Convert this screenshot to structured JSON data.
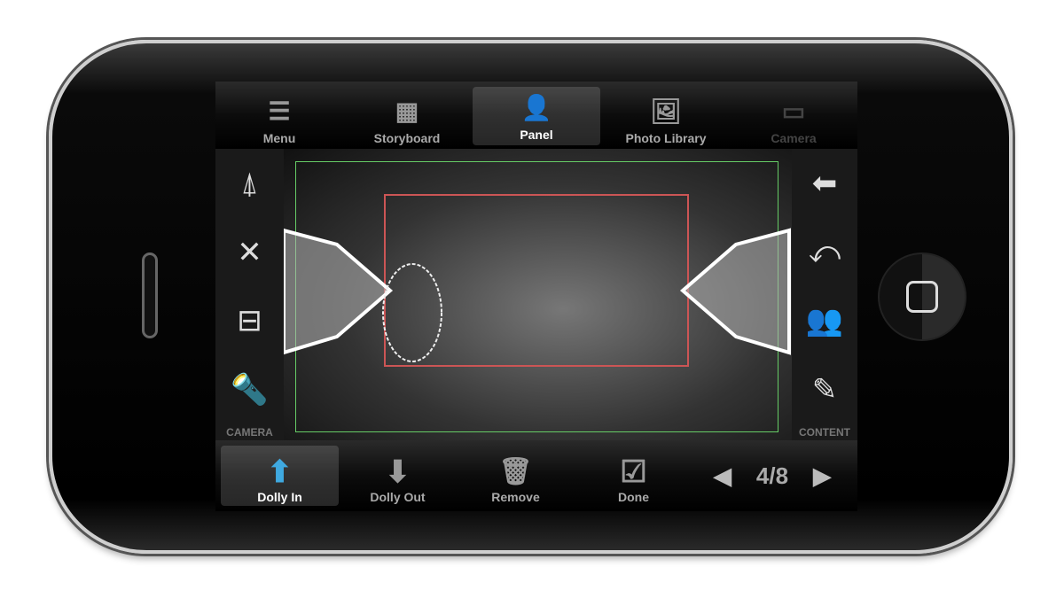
{
  "top_toolbar": {
    "items": [
      {
        "label": "Menu",
        "icon": "list-icon"
      },
      {
        "label": "Storyboard",
        "icon": "storyboard-icon"
      },
      {
        "label": "Panel",
        "icon": "person-panel-icon",
        "selected": true
      },
      {
        "label": "Photo Library",
        "icon": "photos-icon"
      },
      {
        "label": "Camera",
        "icon": "camera-icon",
        "disabled": true
      }
    ]
  },
  "left_panel": {
    "label": "CAMERA",
    "icons": [
      "ladder-icon",
      "collapse-arrows-icon",
      "track-icon",
      "flashlight-icon"
    ]
  },
  "right_panel": {
    "label": "CONTENT",
    "icons": [
      "arrow-left-icon",
      "rotate-icon",
      "figures-icon",
      "pencil-icon"
    ]
  },
  "bottom_toolbar": {
    "items": [
      {
        "label": "Dolly In",
        "icon": "arrow-up-icon",
        "selected": true
      },
      {
        "label": "Dolly Out",
        "icon": "arrow-down-icon"
      },
      {
        "label": "Remove",
        "icon": "trash-icon"
      },
      {
        "label": "Done",
        "icon": "checkbox-icon"
      }
    ],
    "page": "4/8"
  },
  "colors": {
    "accent": "#3fa9e0",
    "frame_outer": "#66cc66",
    "frame_inner": "#cc5555"
  }
}
